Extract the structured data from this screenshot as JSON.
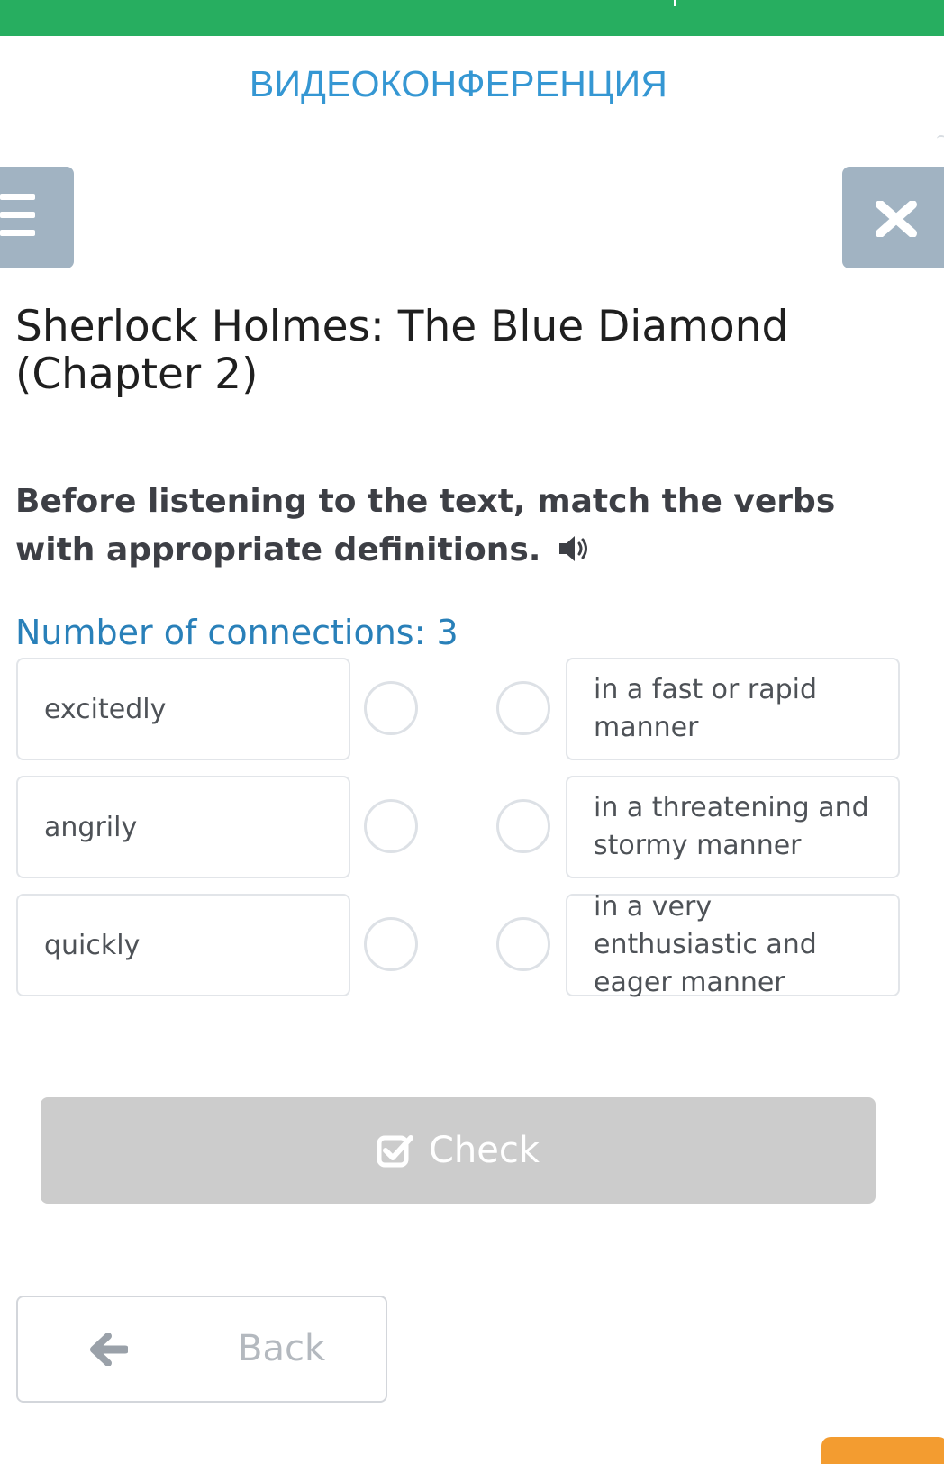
{
  "header": {
    "conference_link": "ВИДЕОКОНФЕРЕНЦИЯ"
  },
  "icons": {
    "menu": "hamburger-icon",
    "close": "close-icon",
    "speaker": "speaker-icon",
    "check": "checkbox-icon",
    "back": "arrow-left-icon"
  },
  "lesson": {
    "title": "Sherlock Holmes: The Blue Diamond (Chapter 2)",
    "instruction": "Before listening to the text, match the verbs with appropriate definitions.",
    "connections_label": "Number of connections: 3"
  },
  "matching": {
    "left_items": [
      {
        "label": "excitedly"
      },
      {
        "label": "angrily"
      },
      {
        "label": "quickly"
      }
    ],
    "right_items": [
      {
        "label": "in a fast or rapid manner"
      },
      {
        "label": "in a threatening and stormy manner"
      },
      {
        "label": "in a very enthusiastic and eager manner"
      }
    ]
  },
  "actions": {
    "check_label": "Check",
    "back_label": "Back"
  },
  "colors": {
    "top_bar": "#27ae60",
    "link_blue": "#3597d3",
    "connections_blue": "#2980b9",
    "button_gray": "#a1b3c2",
    "check_disabled": "#cccccc",
    "orange_tab": "#f39c30"
  }
}
